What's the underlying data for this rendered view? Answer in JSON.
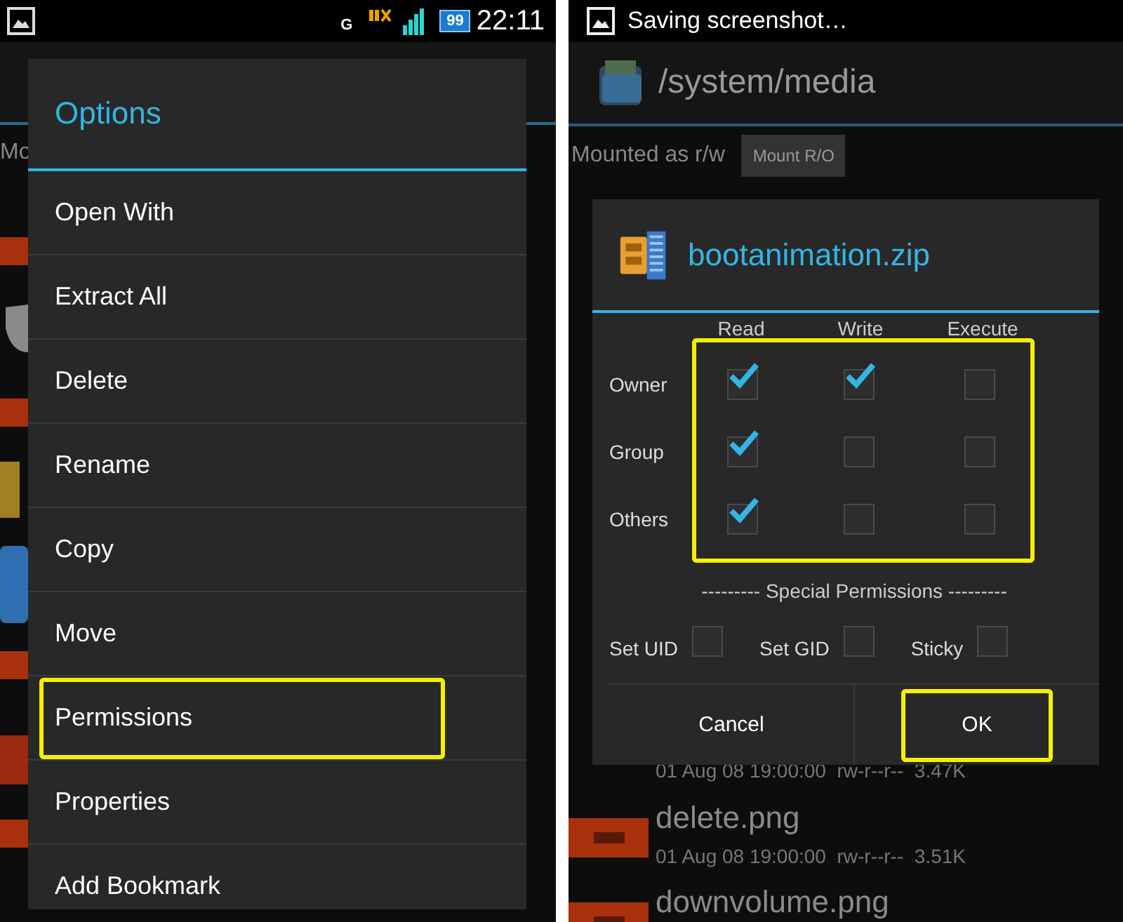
{
  "left_screen": {
    "status_bar": {
      "network_type": "G",
      "battery": "99",
      "time": "22:11"
    },
    "mount_label": "Mo",
    "dialog": {
      "title": "Options",
      "items": [
        {
          "label": "Open With",
          "highlighted": false
        },
        {
          "label": "Extract All",
          "highlighted": false
        },
        {
          "label": "Delete",
          "highlighted": false
        },
        {
          "label": "Rename",
          "highlighted": false
        },
        {
          "label": "Copy",
          "highlighted": false
        },
        {
          "label": "Move",
          "highlighted": false
        },
        {
          "label": "Permissions",
          "highlighted": true
        },
        {
          "label": "Properties",
          "highlighted": false
        },
        {
          "label": "Add Bookmark",
          "highlighted": false
        }
      ]
    }
  },
  "right_screen": {
    "status_bar": {
      "notification": "Saving screenshot…"
    },
    "path": "/system/media",
    "mount_status": "Mounted as r/w",
    "mount_button": "Mount R/O",
    "files": [
      {
        "meta": "01 Aug 08 19:00:00  rw-r--r--  3.47K"
      },
      {
        "name": "delete.png",
        "meta": "01 Aug 08 19:00:00  rw-r--r--  3.51K"
      },
      {
        "name": "downvolume.png"
      }
    ],
    "dialog": {
      "title": "bootanimation.zip",
      "columns": [
        "Read",
        "Write",
        "Execute"
      ],
      "grid_highlighted": true,
      "rows": [
        {
          "label": "Owner",
          "checks": [
            true,
            true,
            false
          ]
        },
        {
          "label": "Group",
          "checks": [
            true,
            false,
            false
          ]
        },
        {
          "label": "Others",
          "checks": [
            true,
            false,
            false
          ]
        }
      ],
      "special_title": "--------- Special Permissions ---------",
      "special": [
        {
          "label": "Set UID",
          "checked": false
        },
        {
          "label": "Set GID",
          "checked": false
        },
        {
          "label": "Sticky",
          "checked": false
        }
      ],
      "buttons": [
        {
          "label": "Cancel",
          "highlighted": false
        },
        {
          "label": "OK",
          "highlighted": true
        }
      ]
    }
  }
}
